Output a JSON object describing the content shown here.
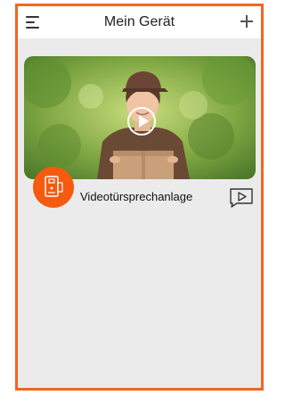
{
  "header": {
    "title": "Mein Gerät",
    "menu_icon": "hamburger-menu-icon",
    "add_icon": "plus-icon"
  },
  "device": {
    "name": "Videotürsprechanlage",
    "device_icon": "intercom-icon",
    "play_icon": "play-icon",
    "playback_icon": "video-playback-icon"
  },
  "colors": {
    "accent": "#f26522",
    "badge": "#f55a0e",
    "background": "#ecebec"
  }
}
